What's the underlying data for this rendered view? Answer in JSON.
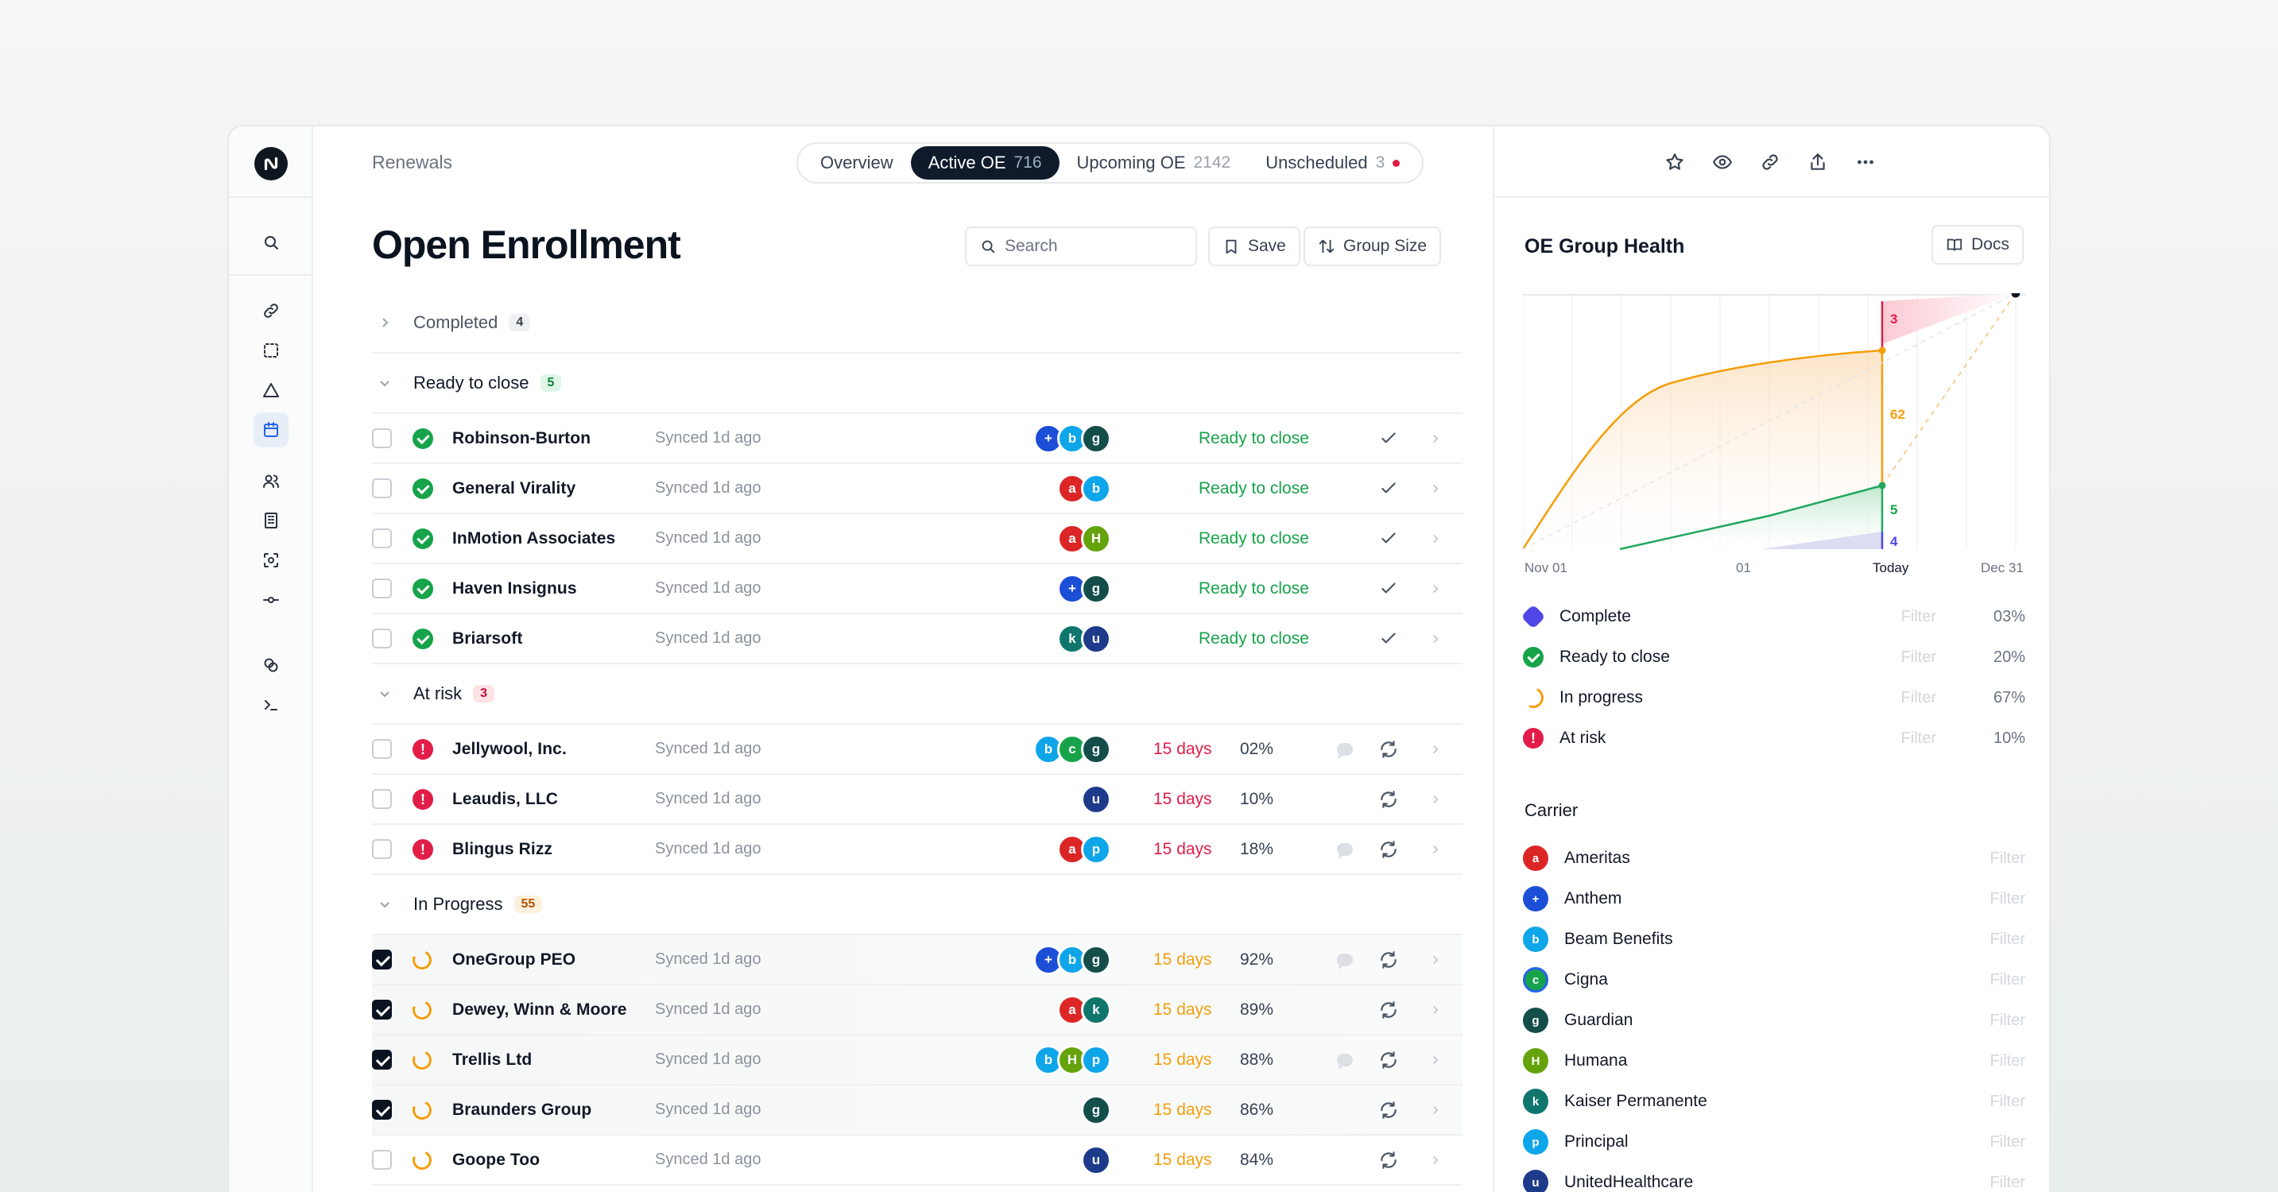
{
  "breadcrumb": "Renewals",
  "tabs": [
    {
      "label": "Overview",
      "count": ""
    },
    {
      "label": "Active OE",
      "count": "716"
    },
    {
      "label": "Upcoming OE",
      "count": "2142"
    },
    {
      "label": "Unscheduled",
      "count": "3"
    }
  ],
  "page_title": "Open Enrollment",
  "toolbar": {
    "search_placeholder": "Search",
    "save_label": "Save",
    "group_label": "Group Size"
  },
  "groups": {
    "completed": {
      "label": "Completed",
      "count": "4"
    },
    "ready": {
      "label": "Ready to close",
      "count": "5"
    },
    "risk": {
      "label": "At risk",
      "count": "3"
    },
    "progress": {
      "label": "In Progress",
      "count": "55"
    }
  },
  "sync_text": "Synced 1d ago",
  "ready_rows": [
    {
      "name": "Robinson-Burton",
      "status": "Ready to close"
    },
    {
      "name": "General Virality",
      "status": "Ready to close"
    },
    {
      "name": "InMotion Associates",
      "status": "Ready to close"
    },
    {
      "name": "Haven Insignus",
      "status": "Ready to close"
    },
    {
      "name": "Briarsoft",
      "status": "Ready to close"
    }
  ],
  "risk_rows": [
    {
      "name": "Jellywool, Inc.",
      "days": "15 days",
      "pct": "02%"
    },
    {
      "name": "Leaudis, LLC",
      "days": "15 days",
      "pct": "10%"
    },
    {
      "name": "Blingus Rizz",
      "days": "15 days",
      "pct": "18%"
    }
  ],
  "progress_rows": [
    {
      "name": "OneGroup PEO",
      "days": "15 days",
      "pct": "92%"
    },
    {
      "name": "Dewey, Winn & Moore",
      "days": "15 days",
      "pct": "89%"
    },
    {
      "name": "Trellis Ltd",
      "days": "15 days",
      "pct": "88%"
    },
    {
      "name": "Braunders Group",
      "days": "15 days",
      "pct": "86%"
    },
    {
      "name": "Goope Too",
      "days": "15 days",
      "pct": "84%"
    }
  ],
  "panel": {
    "title": "OE Group Health",
    "docs_label": "Docs",
    "carrier_heading": "Carrier",
    "filter_label": "Filter"
  },
  "chart_data": {
    "type": "area",
    "x_ticks": [
      "Nov 01",
      "01",
      "Today",
      "Dec 31"
    ],
    "today_values": {
      "at_risk": "3",
      "in_progress": "62",
      "ready": "5",
      "complete": "4"
    }
  },
  "legend": [
    {
      "label": "Complete",
      "pct": "03%"
    },
    {
      "label": "Ready to close",
      "pct": "20%"
    },
    {
      "label": "In progress",
      "pct": "67%"
    },
    {
      "label": "At risk",
      "pct": "10%"
    }
  ],
  "carriers": [
    "Ameritas",
    "Anthem",
    "Beam Benefits",
    "Cigna",
    "Guardian",
    "Humana",
    "Kaiser Permanente",
    "Principal",
    "UnitedHealthcare"
  ],
  "colors": {
    "green": "#16a34a",
    "red": "#e11d48",
    "orange": "#f59e0b",
    "navy": "#0f1a2a"
  }
}
